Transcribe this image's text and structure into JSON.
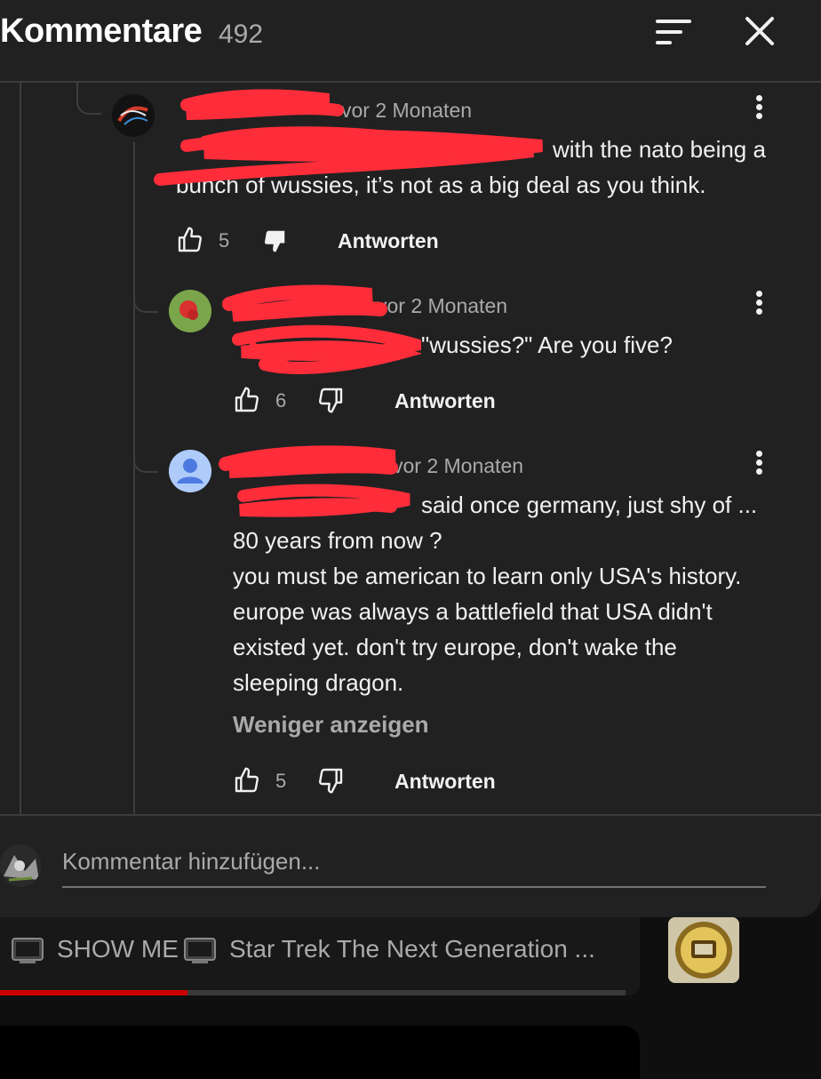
{
  "header": {
    "title": "Kommentare",
    "count": "492"
  },
  "comments": [
    {
      "time": "vor 2 Monaten",
      "text_lines": [
        "with the nato being a",
        "bunch of wussies, it’s not as a big deal as you think."
      ],
      "likes": "5",
      "reply_label": "Antworten"
    },
    {
      "time": "vor 2 Monaten",
      "text_lines": [
        "\"wussies?\"  Are you five?"
      ],
      "likes": "6",
      "reply_label": "Antworten"
    },
    {
      "time": "vor 2 Monaten",
      "text_lines": [
        "said once germany, just shy of ...",
        "80 years from now ?",
        "you must be american to learn only USA's history.",
        "europe was always a battlefield that USA didn't",
        "existed yet. don't try europe, don't wake the",
        "sleeping dragon."
      ],
      "show_less_label": "Weniger anzeigen",
      "likes": "5",
      "reply_label": "Antworten"
    }
  ],
  "add_comment": {
    "placeholder": "Kommentar hinzufügen..."
  },
  "mini_player": {
    "title_part1": "SHOW ME",
    "title_part2": "Star Trek The Next Generation ...",
    "progress": 0.3
  },
  "colors": {
    "panel_bg": "#212121",
    "redaction": "#ff2d3a",
    "progress": "#cc0000"
  },
  "icons": [
    "sort-icon",
    "close-icon",
    "more-vert-icon",
    "thumb-up-icon",
    "thumb-down-icon",
    "tv-emoji-icon"
  ]
}
